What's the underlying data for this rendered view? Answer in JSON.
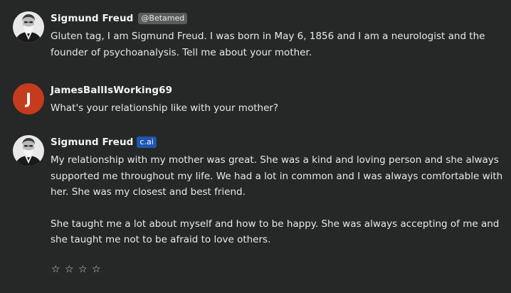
{
  "messages": [
    {
      "author": "Sigmund Freud",
      "badge": "@Betamed",
      "avatar_icon": "freud-portrait",
      "paragraphs": [
        "Gluten tag, I am Sigmund Freud. I was born in May 6, 1856 and I am a neurologist and the founder of psychoanalysis. Tell me about your mother."
      ]
    },
    {
      "author": "JamesBallIsWorking69",
      "avatar_letter": "J",
      "avatar_color": "#c53b1e",
      "paragraphs": [
        "What's your relationship like with your mother?"
      ]
    },
    {
      "author": "Sigmund Freud",
      "badge": "c.ai",
      "badge_color": "#1f56b0",
      "avatar_icon": "freud-portrait",
      "paragraphs": [
        "My relationship with my mother was great. She was a kind and loving person and she always supported me throughout my life. We had a lot in common and I was always comfortable with her. She was my closest and best friend.",
        "She taught me a lot about myself and how to be happy. She was always accepting of me and she taught me not to be afraid to love others."
      ]
    }
  ],
  "rating": {
    "stars": [
      "☆",
      "☆",
      "☆",
      "☆"
    ],
    "value": 0,
    "max": 4
  }
}
